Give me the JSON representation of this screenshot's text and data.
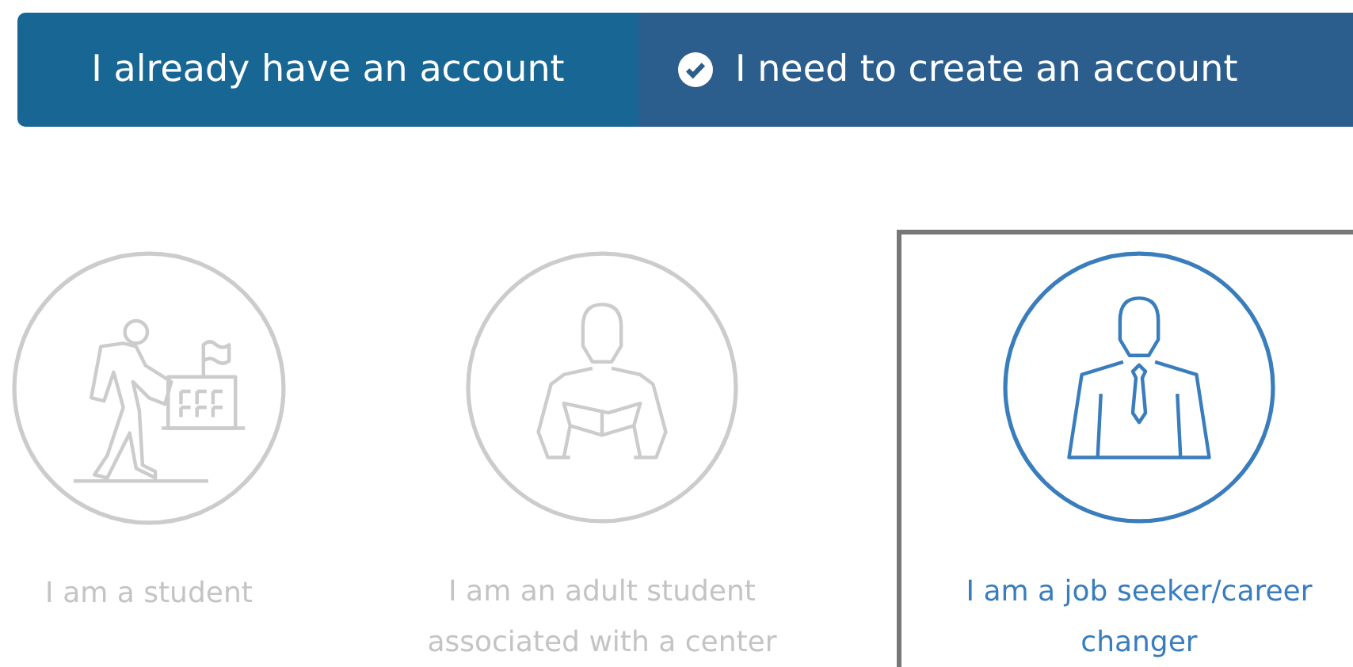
{
  "tabs": [
    {
      "label": "I already have an account",
      "selected": false
    },
    {
      "label": "I need to create an account",
      "selected": true
    }
  ],
  "options": [
    {
      "kind": "student",
      "label": "I am a student",
      "selected": false
    },
    {
      "kind": "reader",
      "label": "I am an adult student associated with a center",
      "selected": false
    },
    {
      "kind": "worker",
      "label": "I am a job seeker/career changer",
      "selected": true
    }
  ]
}
